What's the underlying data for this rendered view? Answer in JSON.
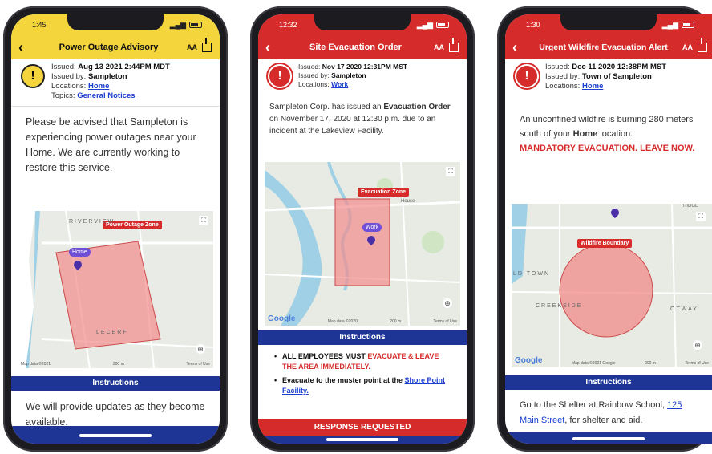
{
  "phones": [
    {
      "status_time": "1:45",
      "title": "Power Outage Advisory",
      "aa": "AA",
      "issued_label": "Issued:",
      "issued_value": "Aug 13 2021 2:44PM MDT",
      "issuedby_label": "Issued by:",
      "issuedby_value": "Sampleton",
      "locations_label": "Locations:",
      "locations_value": "Home",
      "topics_label": "Topics:",
      "topics_value": "General Notices",
      "body": "Please be advised that Sampleton is experiencing power outages near your Home. We are currently working to restore this service.",
      "zone_label": "Power Outage Zone",
      "pin_label": "Home",
      "map_labels": [
        "RIVERVIEW",
        "LECERF"
      ],
      "map_footer_left": "Map data ©2021",
      "map_footer_mid": "200 m",
      "map_footer_right": "Terms of Use",
      "instructions_header": "Instructions",
      "instructions": "We will provide updates as they become available.",
      "header_color": "#f4d53c"
    },
    {
      "status_time": "12:32",
      "title": "Site Evacuation Order",
      "aa": "AA",
      "issued_label": "Issued:",
      "issued_value": "Nov 17 2020 12:31PM MST",
      "issuedby_label": "Issued by:",
      "issuedby_value": "Sampleton",
      "locations_label": "Locations:",
      "locations_value": "Work",
      "body_p1": "Sampleton Corp. has issued an ",
      "body_b1": "Evacuation Order",
      "body_p2": " on November 17, 2020 at 12:30 p.m. due to an incident at the Lakeview Facility.",
      "zone_label": "Evacuation Zone",
      "pin_label": "Work",
      "map_labels": [
        "House"
      ],
      "google": "Google",
      "map_footer_left": "Map data ©2020",
      "map_footer_mid": "200 m",
      "map_footer_right": "Terms of Use",
      "instructions_header": "Instructions",
      "bullet1_a": "ALL EMPLOYEES MUST ",
      "bullet1_b": "EVACUATE & LEAVE THE AREA IMMEDIATELY.",
      "bullet2_a": "Evacuate to the muster point at the ",
      "bullet2_link": "Shore Point Facility.",
      "response_button": "RESPONSE REQUESTED",
      "header_color": "#d62b2b"
    },
    {
      "status_time": "1:30",
      "title": "Urgent Wildfire Evacuation Alert",
      "aa": "AA",
      "issued_label": "Issued:",
      "issued_value": "Dec 11 2020 12:38PM MST",
      "issuedby_label": "Issued by:",
      "issuedby_value": "Town of Sampleton",
      "locations_label": "Locations:",
      "locations_value": "Home",
      "body_p1": "An unconfined wildfire is burning 280 meters south of your ",
      "body_b1": "Home",
      "body_p2": " location.",
      "body_alert": "MANDATORY EVACUATION. LEAVE NOW.",
      "zone_label": "Wildfire Boundary",
      "map_labels": [
        "LD TOWN",
        "CREEKSIDE",
        "OTWAY",
        "RIDGE"
      ],
      "google": "Google",
      "map_footer_left": "Map data ©2021 Google",
      "map_footer_mid": "200 m",
      "map_footer_right": "Terms of Use",
      "instructions_header": "Instructions",
      "instr_p1": "Go to the Shelter at Rainbow School, ",
      "instr_link": "125 Main Street",
      "instr_p2": ", for shelter and aid.",
      "header_color": "#d62b2b"
    }
  ]
}
